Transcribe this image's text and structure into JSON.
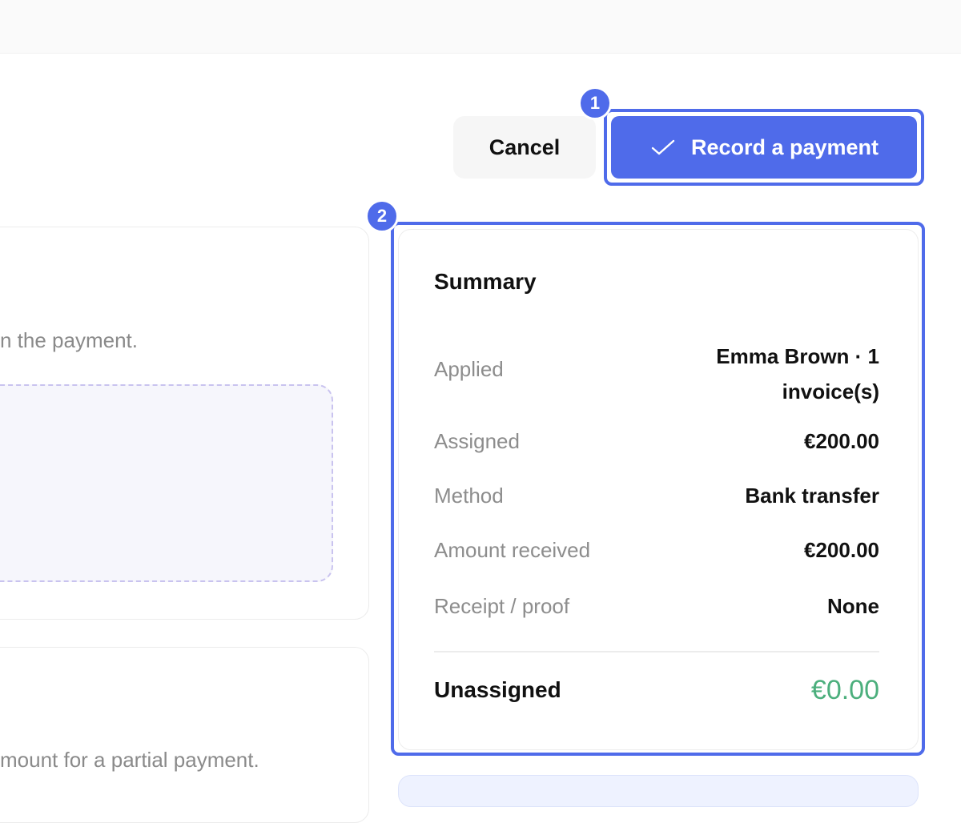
{
  "header": {
    "cancel_label": "Cancel",
    "record_label": "Record a payment"
  },
  "annotations": {
    "badge_1": "1",
    "badge_2": "2",
    "color": "#4f6bea"
  },
  "left_panel": {
    "card1_text": "n the payment.",
    "card2_text": "mount for a partial payment."
  },
  "summary": {
    "title": "Summary",
    "rows": [
      {
        "label": "Applied",
        "value": "Emma Brown · 1 invoice(s)"
      },
      {
        "label": "Assigned",
        "value": "€200.00"
      },
      {
        "label": "Method",
        "value": "Bank transfer"
      },
      {
        "label": "Amount received",
        "value": "€200.00"
      },
      {
        "label": "Receipt / proof",
        "value": "None"
      }
    ],
    "unassigned_label": "Unassigned",
    "unassigned_value": "€0.00",
    "unassigned_color": "#4caf7d"
  },
  "colors": {
    "primary": "#4f6bea",
    "muted_text": "#8d8d8d"
  },
  "icons": {
    "record_button_icon": "check-icon"
  }
}
